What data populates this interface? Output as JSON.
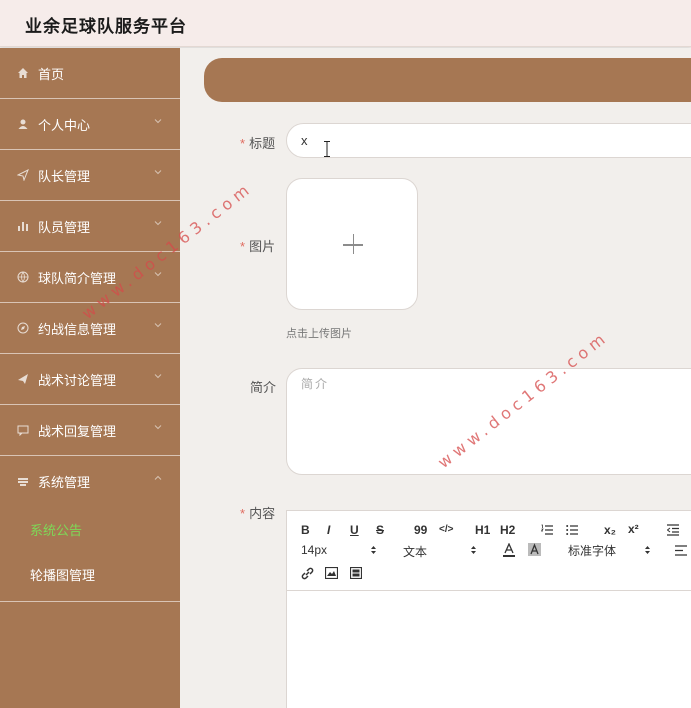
{
  "app": {
    "title": "业余足球队服务平台"
  },
  "sidebar": {
    "items": [
      {
        "label": "首页",
        "icon": "home-icon"
      },
      {
        "label": "个人中心",
        "icon": "user-icon"
      },
      {
        "label": "队长管理",
        "icon": "send-icon"
      },
      {
        "label": "队员管理",
        "icon": "bar-chart-icon"
      },
      {
        "label": "球队简介管理",
        "icon": "globe-icon"
      },
      {
        "label": "约战信息管理",
        "icon": "compass-icon"
      },
      {
        "label": "战术讨论管理",
        "icon": "paper-plane-icon"
      },
      {
        "label": "战术回复管理",
        "icon": "message-icon"
      },
      {
        "label": "系统管理",
        "icon": "menu-icon"
      }
    ],
    "sub_items": [
      {
        "label": "系统公告",
        "active": true
      },
      {
        "label": "轮播图管理",
        "active": false
      }
    ],
    "active_color": "#7ed957",
    "bg_color": "#a67753"
  },
  "form": {
    "title_label": "标题",
    "title_value": "x",
    "image_label": "图片",
    "upload_hint": "点击上传图片",
    "intro_label": "简介",
    "intro_placeholder": "简介",
    "content_label": "内容",
    "required_mark": "*"
  },
  "editor": {
    "toolbar_row1": [
      "B",
      "I",
      "U",
      "S",
      "99",
      "</>",
      "H1",
      "H2",
      "ordered-list",
      "bullet-list",
      "x₂",
      "x²",
      "indent"
    ],
    "font_size": "14px",
    "text_style": "文本",
    "font_family": "标准字体"
  },
  "watermark": {
    "text": "www.doc163.com"
  }
}
